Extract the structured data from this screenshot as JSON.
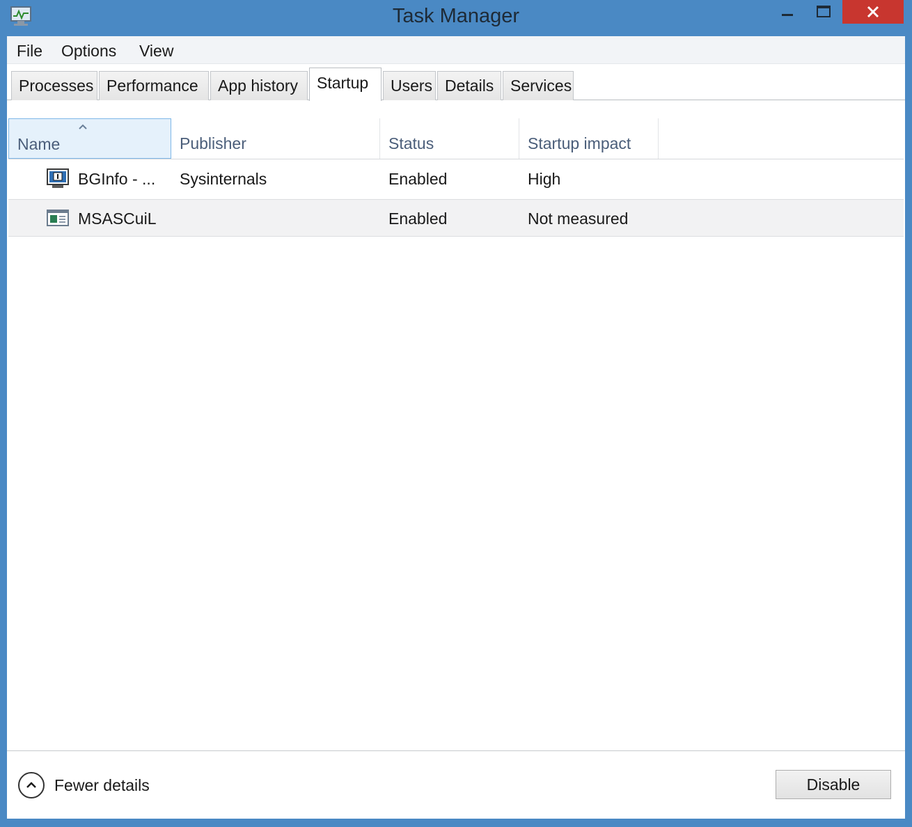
{
  "window": {
    "title": "Task Manager"
  },
  "menu": [
    "File",
    "Options",
    "View"
  ],
  "tabs": [
    {
      "label": "Processes",
      "active": false
    },
    {
      "label": "Performance",
      "active": false
    },
    {
      "label": "App history",
      "active": false
    },
    {
      "label": "Startup",
      "active": true
    },
    {
      "label": "Users",
      "active": false
    },
    {
      "label": "Details",
      "active": false
    },
    {
      "label": "Services",
      "active": false
    }
  ],
  "table": {
    "columns": [
      "Name",
      "Publisher",
      "Status",
      "Startup impact"
    ],
    "sorted_column": "Name",
    "sort_direction": "ascending",
    "rows": [
      {
        "icon": "bginfo-app-icon",
        "name": "BGInfo - ...",
        "publisher": "Sysinternals",
        "status": "Enabled",
        "impact": "High",
        "selected": false
      },
      {
        "icon": "window-app-icon",
        "name": "MSASCuiL",
        "publisher": "",
        "status": "Enabled",
        "impact": "Not measured",
        "selected": true
      }
    ]
  },
  "footer": {
    "fewer_details": "Fewer details",
    "disable_button": "Disable"
  },
  "colors": {
    "title_bar": "#4a89c4",
    "close_button": "#c8362f",
    "sorted_header_bg": "#e5f1fb",
    "selected_row_bg": "#f2f2f3"
  }
}
